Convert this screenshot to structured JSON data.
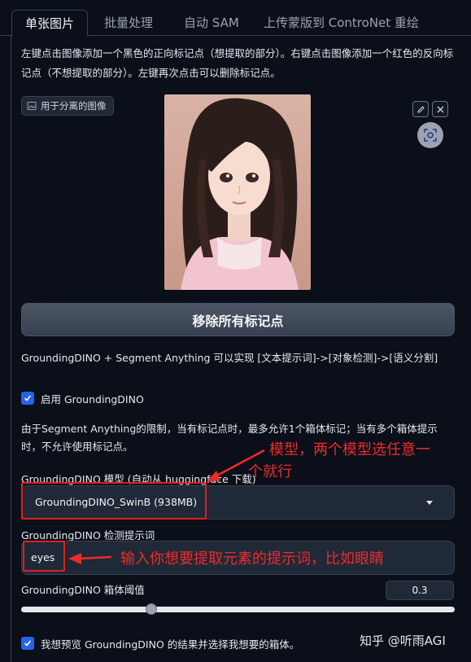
{
  "tabs": [
    "单张图片",
    "批量处理",
    "自动 SAM",
    "上传蒙版到 ControNet 重绘"
  ],
  "description": "左键点击图像添加一个黑色的正向标记点（想提取的部分）。右键点击图像添加一个红色的反向标记点（不想提取的部分）。左键再次点击可以删除标记点。",
  "image_panel": {
    "label": "用于分离的图像",
    "image_icon": "image-icon",
    "edit_icon": "pencil-icon",
    "close_icon": "close-icon",
    "scan_icon": "scan-focus-icon"
  },
  "remove_button": "移除所有标记点",
  "grounding_info": "GroundingDINO + Segment Anything 可以实现 [文本提示词]->[对象检测]->[语义分割]",
  "enable_checkbox": {
    "label": "启用 GroundingDINO",
    "checked": true
  },
  "limit_note": "由于Segment Anything的限制，当有标记点时，最多允许1个箱体标记；当有多个箱体提示时，不允许使用标记点。",
  "model": {
    "label": "GroundingDINO 模型 (自动从 huggingface 下载)",
    "value": "GroundingDINO_SwinB (938MB)"
  },
  "prompt": {
    "label": "GroundingDINO 检测提示词",
    "value": "eyes"
  },
  "threshold": {
    "label": "GroundingDINO 箱体阈值",
    "value": "0.3",
    "fraction": 0.3
  },
  "preview_checkbox": {
    "label": "我想预览 GroundingDINO 的结果并选择我想要的箱体。",
    "checked": true
  },
  "annotations": {
    "model_note_line1": "模型，两个模型选任意一",
    "model_note_line2": "个就行",
    "prompt_note": "输入你想要提取元素的提示词，比如眼睛",
    "color": "#ef2b2b"
  },
  "watermark": "知乎 @听雨AGI"
}
